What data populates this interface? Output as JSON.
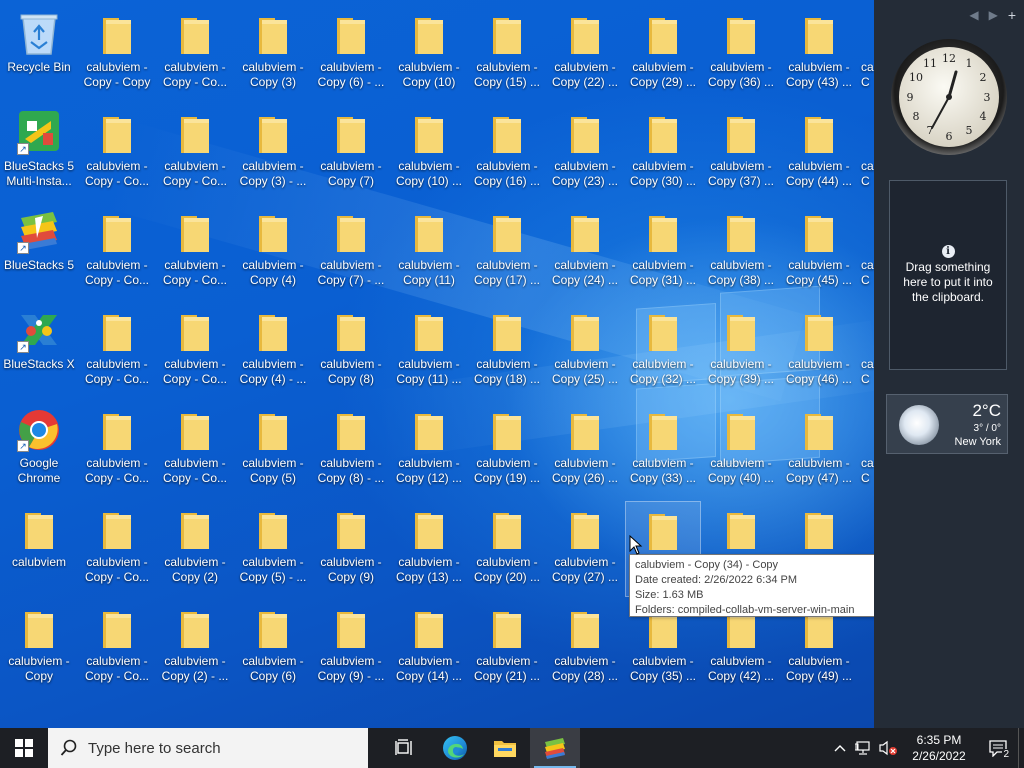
{
  "desktop_icons": [
    {
      "label": "Recycle Bin",
      "type": "recycle"
    },
    {
      "label": "BlueStacks 5\nMulti-Insta...",
      "type": "bluestacks-multi"
    },
    {
      "label": "BlueStacks 5",
      "type": "bluestacks"
    },
    {
      "label": "BlueStacks X",
      "type": "bluestacks-x"
    },
    {
      "label": "Google\nChrome",
      "type": "chrome"
    },
    {
      "label": "calubviem",
      "type": "folder"
    },
    {
      "label": "calubviem -\nCopy",
      "type": "folder"
    },
    {
      "label": "calubviem -\nCopy - Copy",
      "type": "folder"
    },
    {
      "label": "calubviem -\nCopy - Co...",
      "type": "folder"
    },
    {
      "label": "calubviem -\nCopy - Co...",
      "type": "folder"
    },
    {
      "label": "calubviem -\nCopy - Co...",
      "type": "folder"
    },
    {
      "label": "calubviem -\nCopy - Co...",
      "type": "folder"
    },
    {
      "label": "calubviem -\nCopy - Co...",
      "type": "folder"
    },
    {
      "label": "calubviem -\nCopy - Co...",
      "type": "folder"
    },
    {
      "label": "calubviem -\nCopy - Co...",
      "type": "folder"
    },
    {
      "label": "calubviem -\nCopy - Co...",
      "type": "folder"
    },
    {
      "label": "calubviem -\nCopy - Co...",
      "type": "folder"
    },
    {
      "label": "calubviem -\nCopy - Co...",
      "type": "folder"
    },
    {
      "label": "calubviem -\nCopy - Co...",
      "type": "folder"
    },
    {
      "label": "calubviem -\nCopy (2)",
      "type": "folder"
    },
    {
      "label": "calubviem -\nCopy (2) - ...",
      "type": "folder"
    },
    {
      "label": "calubviem -\nCopy (3)",
      "type": "folder"
    },
    {
      "label": "calubviem -\nCopy (3) - ...",
      "type": "folder"
    },
    {
      "label": "calubviem -\nCopy (4)",
      "type": "folder"
    },
    {
      "label": "calubviem -\nCopy (4) - ...",
      "type": "folder"
    },
    {
      "label": "calubviem -\nCopy (5)",
      "type": "folder"
    },
    {
      "label": "calubviem -\nCopy (5) - ...",
      "type": "folder"
    },
    {
      "label": "calubviem -\nCopy (6)",
      "type": "folder"
    },
    {
      "label": "calubviem -\nCopy (6) - ...",
      "type": "folder"
    },
    {
      "label": "calubviem -\nCopy (7)",
      "type": "folder"
    },
    {
      "label": "calubviem -\nCopy (7) - ...",
      "type": "folder"
    },
    {
      "label": "calubviem -\nCopy (8)",
      "type": "folder"
    },
    {
      "label": "calubviem -\nCopy (8) - ...",
      "type": "folder"
    },
    {
      "label": "calubviem -\nCopy (9)",
      "type": "folder"
    },
    {
      "label": "calubviem -\nCopy (9) - ...",
      "type": "folder"
    },
    {
      "label": "calubviem -\nCopy (10)",
      "type": "folder"
    },
    {
      "label": "calubviem -\nCopy (10) ...",
      "type": "folder"
    },
    {
      "label": "calubviem -\nCopy (11)",
      "type": "folder"
    },
    {
      "label": "calubviem -\nCopy (11) ...",
      "type": "folder"
    },
    {
      "label": "calubviem -\nCopy (12) ...",
      "type": "folder"
    },
    {
      "label": "calubviem -\nCopy (13) ...",
      "type": "folder"
    },
    {
      "label": "calubviem -\nCopy (14) ...",
      "type": "folder"
    },
    {
      "label": "calubviem -\nCopy (15) ...",
      "type": "folder"
    },
    {
      "label": "calubviem -\nCopy (16) ...",
      "type": "folder"
    },
    {
      "label": "calubviem -\nCopy (17) ...",
      "type": "folder"
    },
    {
      "label": "calubviem -\nCopy (18) ...",
      "type": "folder"
    },
    {
      "label": "calubviem -\nCopy (19) ...",
      "type": "folder"
    },
    {
      "label": "calubviem -\nCopy (20) ...",
      "type": "folder"
    },
    {
      "label": "calubviem -\nCopy (21) ...",
      "type": "folder"
    },
    {
      "label": "calubviem -\nCopy (22) ...",
      "type": "folder"
    },
    {
      "label": "calubviem -\nCopy (23) ...",
      "type": "folder"
    },
    {
      "label": "calubviem -\nCopy (24) ...",
      "type": "folder"
    },
    {
      "label": "calubviem -\nCopy (25) ...",
      "type": "folder"
    },
    {
      "label": "calubviem -\nCopy (26) ...",
      "type": "folder"
    },
    {
      "label": "calubviem -\nCopy (27) ...",
      "type": "folder"
    },
    {
      "label": "calubviem -\nCopy (28) ...",
      "type": "folder"
    },
    {
      "label": "calubviem -\nCopy (29) ...",
      "type": "folder"
    },
    {
      "label": "calubviem -\nCopy (30) ...",
      "type": "folder"
    },
    {
      "label": "calubviem -\nCopy (31) ...",
      "type": "folder"
    },
    {
      "label": "calubviem -\nCopy (32) ...",
      "type": "folder"
    },
    {
      "label": "calubviem -\nCopy (33) ...",
      "type": "folder"
    },
    {
      "label": "",
      "type": "folder"
    },
    {
      "label": "calubviem -\nCopy (35) ...",
      "type": "folder"
    },
    {
      "label": "calubviem -\nCopy (36) ...",
      "type": "folder"
    },
    {
      "label": "calubviem -\nCopy (37) ...",
      "type": "folder"
    },
    {
      "label": "calubviem -\nCopy (38) ...",
      "type": "folder"
    },
    {
      "label": "calubviem -\nCopy (39) ...",
      "type": "folder"
    },
    {
      "label": "calubviem -\nCopy (40) ...",
      "type": "folder"
    },
    {
      "label": "",
      "type": "folder"
    },
    {
      "label": "calubviem -\nCopy (42) ...",
      "type": "folder"
    },
    {
      "label": "calubviem -\nCopy (43) ...",
      "type": "folder"
    },
    {
      "label": "calubviem -\nCopy (44) ...",
      "type": "folder"
    },
    {
      "label": "calubviem -\nCopy (45) ...",
      "type": "folder"
    },
    {
      "label": "calubviem -\nCopy (46) ...",
      "type": "folder"
    },
    {
      "label": "calubviem -\nCopy (47) ...",
      "type": "folder"
    },
    {
      "label": "",
      "type": "folder"
    },
    {
      "label": "calubviem -\nCopy (49) ...",
      "type": "folder"
    },
    {
      "label": "ca\nC",
      "type": "partial"
    },
    {
      "label": "ca\nC",
      "type": "partial"
    },
    {
      "label": "ca\nC",
      "type": "partial"
    },
    {
      "label": "ca\nC",
      "type": "partial"
    },
    {
      "label": "ca\nC",
      "type": "partial"
    }
  ],
  "tooltip": {
    "line1": "calubviem - Copy (34) - Copy",
    "line2": "Date created: 2/26/2022 6:34 PM",
    "line3": "Size: 1.63 MB",
    "line4": "Folders: compiled-collab-vm-server-win-main"
  },
  "sidebar": {
    "nav_prev": "◀",
    "nav_next": "▶",
    "add": "+",
    "clipboard_text": "Drag something here to put it into the clipboard.",
    "clipboard_info": "i",
    "weather": {
      "temp": "2°C",
      "range": "3° / 0°",
      "city": "New York"
    }
  },
  "taskbar": {
    "search_placeholder": "Type here to search",
    "time": "6:35 PM",
    "date": "2/26/2022",
    "notification_count": "2"
  },
  "colors": {
    "folder": "#f7d774",
    "taskbar": "#1d1f24",
    "sidebar": "#242c37"
  }
}
